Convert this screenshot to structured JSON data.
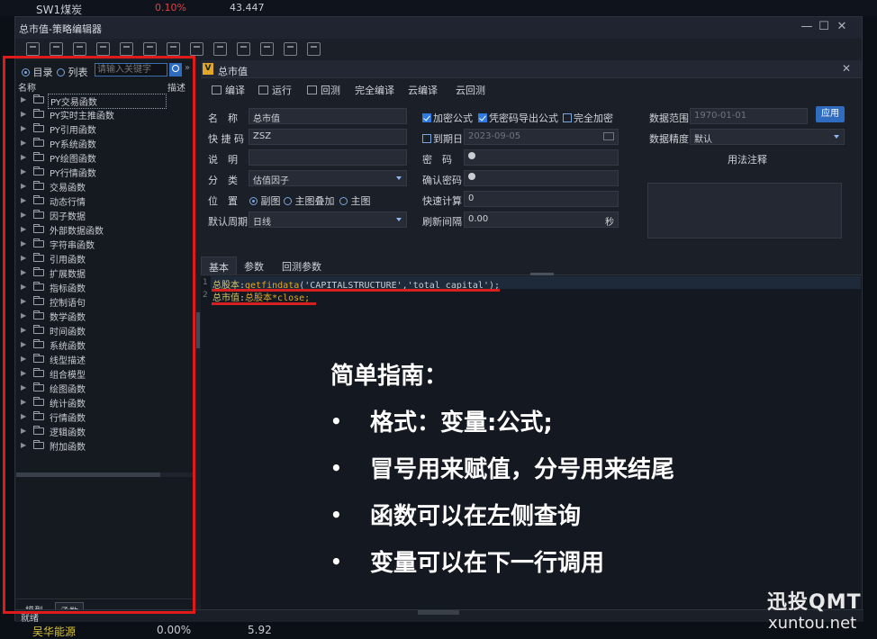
{
  "background": {
    "top_left_label": "SW1煤炭",
    "top_change": "0.10%",
    "top_value": "43.447",
    "bottom_name": "吴华能源",
    "bottom_change": "0.00%",
    "bottom_value": "5.92"
  },
  "window": {
    "title": "总市值-策略编辑器",
    "controls": {
      "minimize": "—",
      "maximize": "☐",
      "close": "✕"
    }
  },
  "left_panel": {
    "view_options": [
      "目录",
      "列表"
    ],
    "search_placeholder": "请输入关键字",
    "more": "»",
    "col_name": "名称",
    "col_desc": "描述",
    "tree": [
      "PY交易函数",
      "PY实时主推函数",
      "PY引用函数",
      "PY系统函数",
      "PY绘图函数",
      "PY行情函数",
      "交易函数",
      "动态行情",
      "因子数据",
      "外部数据函数",
      "字符串函数",
      "引用函数",
      "扩展数据",
      "指标函数",
      "控制语句",
      "数学函数",
      "时间函数",
      "系统函数",
      "线型描述",
      "组合模型",
      "绘图函数",
      "统计函数",
      "行情函数",
      "逻辑函数",
      "附加函数"
    ],
    "bottom_tabs": [
      "模型",
      "函数"
    ]
  },
  "doc_tab": {
    "icon": "V",
    "name": "总市值",
    "close": "✕"
  },
  "actions": [
    "编译",
    "运行",
    "回测",
    "完全编译",
    "云编译",
    "云回测"
  ],
  "form": {
    "name_label": "名　称",
    "name_value": "总市值",
    "shortcut_label": "快 捷 码",
    "shortcut_value": "ZSZ",
    "desc_label": "说　明",
    "desc_value": "",
    "category_label": "分　类",
    "category_value": "估值因子",
    "position_label": "位　置",
    "position_options": [
      "副图",
      "主图叠加",
      "主图"
    ],
    "period_label": "默认周期",
    "period_value": "日线",
    "encrypt_formula": "加密公式",
    "export_with_password": "凭密码导出公式",
    "full_encrypt": "完全加密",
    "expire_label": "到期日",
    "expire_value": "2023-09-05",
    "password_label": "密　码",
    "confirm_password_label": "确认密码",
    "fast_calc_label": "快速计算",
    "fast_calc_value": "0",
    "refresh_label": "刷新间隔",
    "refresh_value": "0.00",
    "refresh_unit": "秒",
    "data_range_label": "数据范围",
    "data_range_value": "1970-01-01",
    "apply_label": "应用",
    "data_precision_label": "数据精度",
    "data_precision_value": "默认",
    "usage_notes_label": "用法注释"
  },
  "sub_tabs": [
    "基本",
    "参数",
    "回测参数"
  ],
  "code": {
    "line1_num": "1",
    "line1_var": "总股本",
    "line1_colon": ":",
    "line1_fn": "getfindata",
    "line1_args": "('CAPITALSTRUCTURE','total_capital');",
    "line2_num": "2",
    "line2_var": "总市值",
    "line2_colon": ":",
    "line2_expr": "总股本*close;"
  },
  "guide": {
    "heading": "简单指南：",
    "items": [
      "格式：变量:公式;",
      "冒号用来赋值，分号用来结尾",
      "函数可以在左侧查询",
      "变量可以在下一行调用"
    ],
    "bullet": "•"
  },
  "status": "就绪",
  "watermark": {
    "line1": "迅投QMT",
    "line2": "xuntou.net"
  },
  "colors": {
    "accent": "#2f6bbf",
    "highlight_box": "#e01a1a",
    "code_var": "#d7c46b",
    "code_fn": "#e0a72a"
  }
}
